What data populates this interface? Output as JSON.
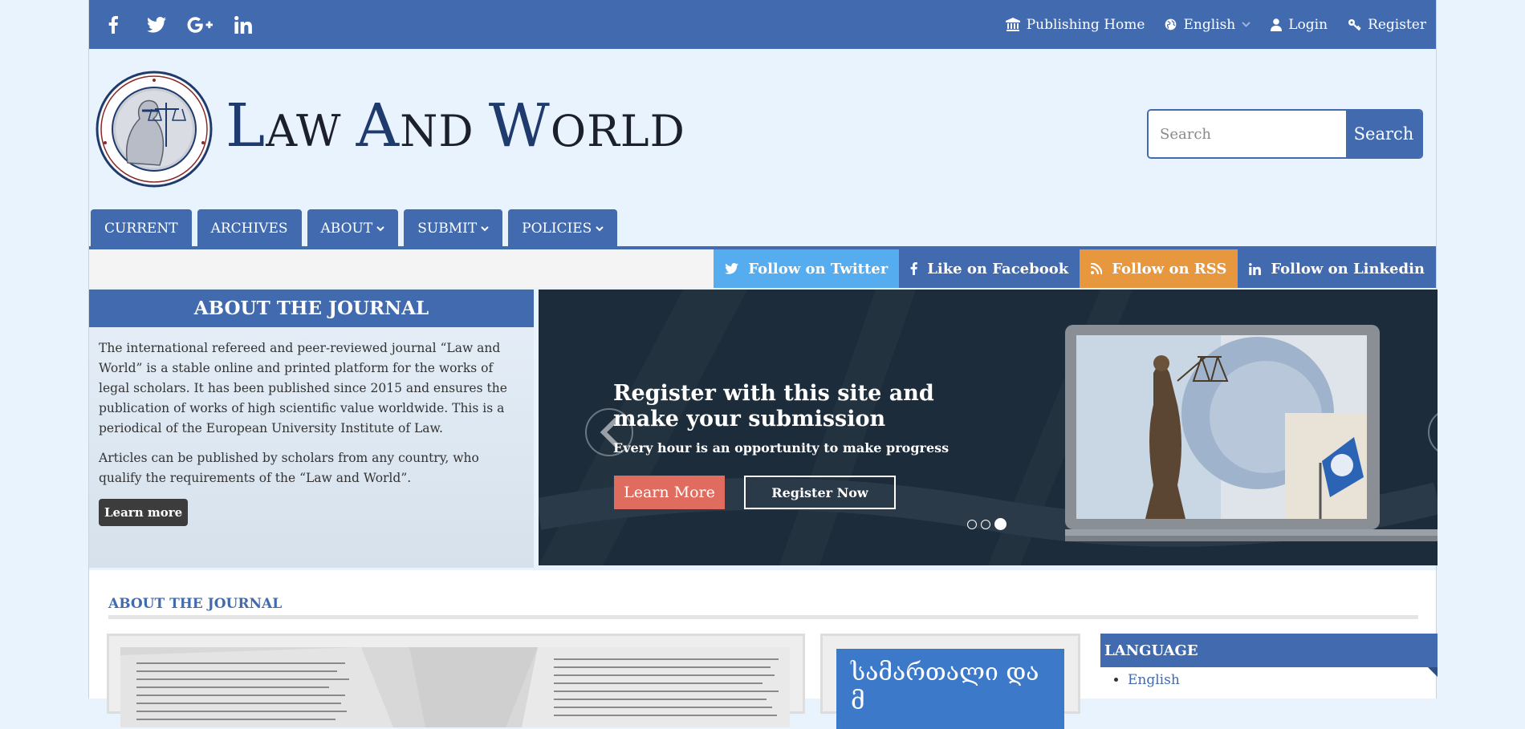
{
  "topbar": {
    "social_icons": [
      "facebook-icon",
      "twitter-icon",
      "google-plus-icon",
      "linkedin-icon"
    ],
    "links": {
      "publishing_home": "Publishing Home",
      "language": "English",
      "login": "Login",
      "register": "Register"
    }
  },
  "header": {
    "site_title": {
      "c1": "L",
      "r1": "AW ",
      "c2": "A",
      "r2": "ND ",
      "c3": "W",
      "r3": "ORLD"
    },
    "search": {
      "placeholder": "Search",
      "button": "Search"
    }
  },
  "nav": {
    "items": [
      {
        "label": "CURRENT",
        "dropdown": false
      },
      {
        "label": "ARCHIVES",
        "dropdown": false
      },
      {
        "label": "ABOUT",
        "dropdown": true
      },
      {
        "label": "SUBMIT",
        "dropdown": true
      },
      {
        "label": "POLICIES",
        "dropdown": true
      }
    ]
  },
  "follow": {
    "twitter": "Follow on Twitter",
    "facebook": "Like on Facebook",
    "rss": "Follow on RSS",
    "linkedin": "Follow on Linkedin"
  },
  "about_panel": {
    "heading": "ABOUT THE JOURNAL",
    "para1": "The international refereed and peer-reviewed journal “Law and World” is a stable online and printed platform for the works of legal scholars. It has been published since 2015 and ensures the publication of works of high scientific value worldwide. This is a periodical of the European University Institute of Law.",
    "para2": "Articles can be published by scholars from any country, who qualify the requirements of the “Law and World”.",
    "button": "Learn more"
  },
  "slider": {
    "title": "Register with this site and make your submission",
    "subtitle": "Every hour is an opportunity to make progress",
    "learn_more": "Learn More",
    "register_now": "Register Now",
    "slide_count": 3,
    "active_slide": 3
  },
  "content": {
    "heading": "ABOUT THE JOURNAL",
    "card2_text": "სამართალი და მ"
  },
  "sidebar": {
    "language_heading": "LANGUAGE",
    "languages": [
      "English"
    ]
  },
  "colors": {
    "primary": "#426aaf",
    "twitter": "#55acee",
    "rss": "#e7973d",
    "learn_more": "#e06c5f"
  }
}
